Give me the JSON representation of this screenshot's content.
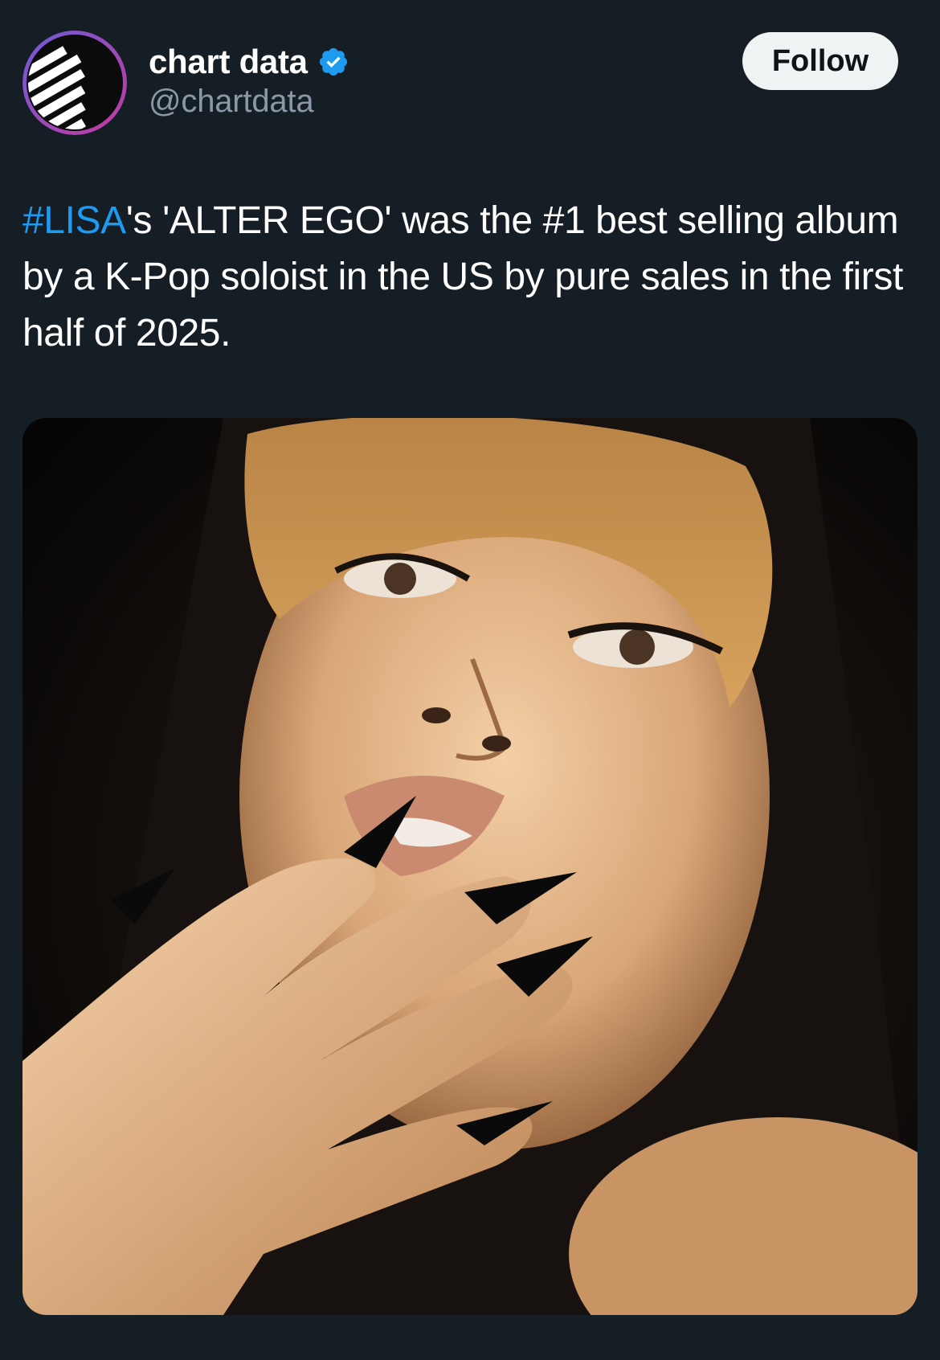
{
  "account": {
    "display_name": "chart data",
    "handle": "@chartdata",
    "verified": true,
    "verified_color": "#1d9bf0"
  },
  "follow_button": {
    "label": "Follow"
  },
  "post": {
    "hashtag": "#LISA",
    "text_after_hashtag": "'s 'ALTER EGO' was the #1 best selling album by a K-Pop soloist in the US by pure sales in the first half of 2025.",
    "link_color": "#1d9bf0"
  },
  "media": {
    "icon": "photo"
  },
  "colors": {
    "background": "#151d25",
    "text": "#ffffff",
    "secondary_text": "#8b98a5",
    "button_bg": "#eff3f4"
  }
}
